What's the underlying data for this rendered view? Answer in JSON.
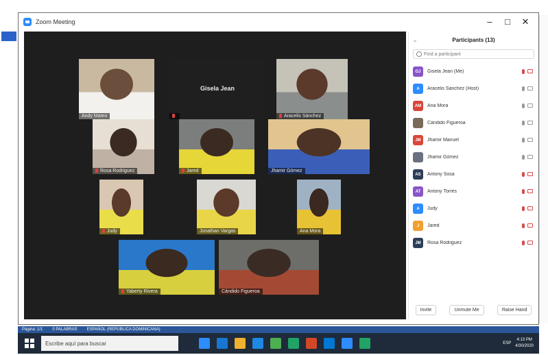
{
  "window": {
    "title": "Zoom Meeting",
    "controls": [
      "–",
      "□",
      "✕"
    ]
  },
  "tiles": [
    {
      "name": "Andy Mateo",
      "muted": false,
      "photo_colors": [
        "#c9b9a0",
        "#f3f1ee",
        "#6b4e3b"
      ]
    },
    {
      "name": "",
      "big_name": "Gisela Jean",
      "muted": true,
      "photo_colors": [
        "#1f1f1f",
        "#1f1f1f",
        "#1f1f1f"
      ]
    },
    {
      "name": "Aracelis Sánchez",
      "muted": true,
      "photo_colors": [
        "#c5c2b8",
        "#8a8e8c",
        "#5b3a2c"
      ]
    },
    {
      "name": "Rosa Rodriguez",
      "muted": true,
      "photo_colors": [
        "#e7dfd4",
        "#bfb1a3",
        "#3b2a22"
      ]
    },
    {
      "name": "Jared",
      "muted": true,
      "photo_colors": [
        "#7b7e7d",
        "#e6d638",
        "#3b2a22"
      ]
    },
    {
      "name": "Jhamir Gómez",
      "muted": false,
      "photo_colors": [
        "#e2c48f",
        "#3b5fb8",
        "#4d3326"
      ]
    },
    {
      "name": "Judy",
      "muted": true,
      "photo_colors": [
        "#d9c7b2",
        "#eadd4a",
        "#5a3a2a"
      ]
    },
    {
      "name": "Jonathan Vargas",
      "muted": false,
      "photo_colors": [
        "#d9d8d2",
        "#e8d548",
        "#5b3a2a"
      ]
    },
    {
      "name": "Ana Mora",
      "muted": false,
      "photo_colors": [
        "#9fb2c4",
        "#e7c234",
        "#3b2820"
      ]
    },
    {
      "name": "Yaberty Rivera",
      "muted": true,
      "photo_colors": [
        "#2a78c9",
        "#d7cf3e",
        "#3b2a20"
      ]
    },
    {
      "name": "Cándido Figueroa",
      "muted": false,
      "active": true,
      "photo_colors": [
        "#6d6e6a",
        "#a44a34",
        "#3a2c24"
      ]
    }
  ],
  "participants": {
    "title": "Participants (13)",
    "search_placeholder": "Find a participant",
    "list": [
      {
        "initials": "GJ",
        "color": "#8a55c8",
        "name": "Gisela Jean (Me)",
        "mic": "muted",
        "cam": "off"
      },
      {
        "initials": "A",
        "color": "#2d8cff",
        "name": "Aracelis Sánchez (Host)",
        "mic": "on",
        "cam": "on"
      },
      {
        "initials": "AM",
        "color": "#d9463a",
        "name": "Ana Mora",
        "mic": "on",
        "cam": "on"
      },
      {
        "initials": "",
        "color": "#7a6a5a",
        "name": "Cándido Figueroa",
        "mic": "on",
        "cam": "on"
      },
      {
        "initials": "JM",
        "color": "#d9463a",
        "name": "Jhamir Manuel",
        "mic": "on",
        "cam": "on"
      },
      {
        "initials": "",
        "color": "#6a7080",
        "name": "Jhamir Gómez",
        "mic": "on",
        "cam": "on"
      },
      {
        "initials": "AS",
        "color": "#2c3e57",
        "name": "Antony Sosa",
        "mic": "muted",
        "cam": "off"
      },
      {
        "initials": "AT",
        "color": "#8a55c8",
        "name": "Antony Torres",
        "mic": "muted",
        "cam": "off"
      },
      {
        "initials": "A",
        "color": "#2d8cff",
        "name": "Judy",
        "mic": "muted",
        "cam": "off"
      },
      {
        "initials": "J",
        "color": "#f0a030",
        "name": "Jared",
        "mic": "muted",
        "cam": "off"
      },
      {
        "initials": "JM",
        "color": "#2c3e57",
        "name": "Rosa Rodriguez",
        "mic": "muted",
        "cam": "off"
      }
    ],
    "footer": [
      "Invite",
      "Unmute Me",
      "Raise Hand"
    ]
  },
  "statusbar": [
    "Página: 1/1",
    "0 PALABRAS",
    "ESPAÑOL (REPÚBLICA DOMINICANA)"
  ],
  "taskbar": {
    "search_text": "Escribe aquí para buscar",
    "app_colors": [
      "#2d8cff",
      "#1976d2",
      "#f0b030",
      "#1e88e5",
      "#4caf50",
      "#21a366",
      "#d24726",
      "#0078d4",
      "#2d8cff",
      "#21a366"
    ],
    "tray_text": "ESP",
    "time": "4:13 PM",
    "date": "4/30/2020"
  }
}
